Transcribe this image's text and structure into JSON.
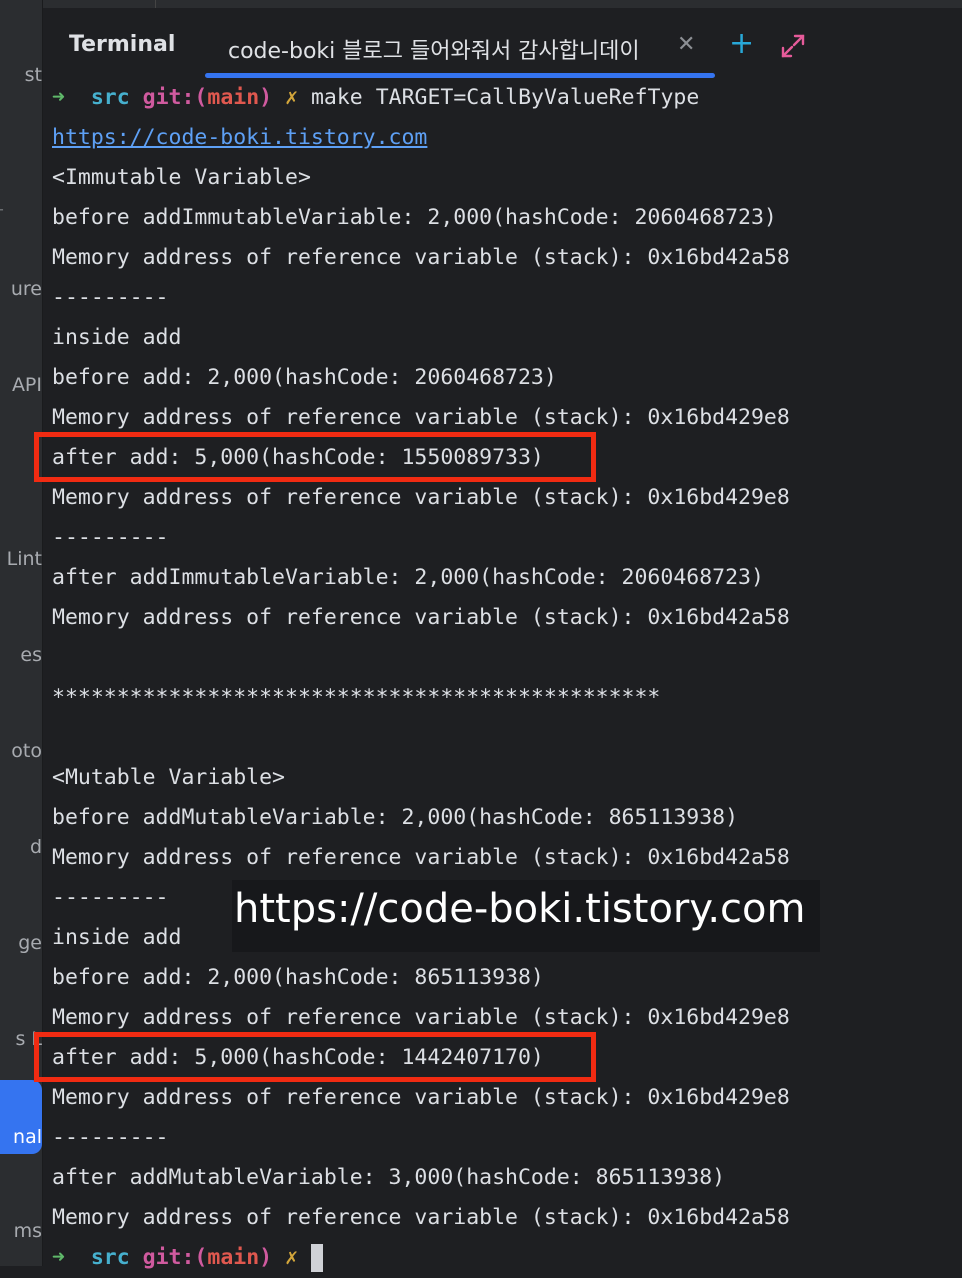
{
  "sidebar": {
    "items": [
      "st",
      "ure",
      "API",
      "Lint",
      "es",
      "oto",
      "d",
      "ge",
      "s L",
      "nal",
      "ms"
    ],
    "active_item": "nal"
  },
  "tabs": {
    "terminal_label": "Terminal",
    "active_tab_label": "code-boki 블로그 들어와줘서 감사합니데이",
    "close_icon": "close-icon",
    "new_tab_icon": "plus-icon",
    "expand_icon": "expand-icon"
  },
  "prompt": {
    "arrow": "➜",
    "dir": "src",
    "git_prefix": "git:(",
    "branch": "main",
    "git_suffix": ")",
    "dirty": "✗",
    "command": "make TARGET=CallByValueRefType"
  },
  "output": {
    "link": "https://code-boki.tistory.com",
    "lines": [
      "<Immutable Variable>",
      "before addImmutableVariable: 2,000(hashCode: 2060468723)",
      "Memory address of reference variable (stack): 0x16bd42a58",
      "---------",
      "inside add",
      "before add: 2,000(hashCode: 2060468723)",
      "Memory address of reference variable (stack): 0x16bd429e8",
      "after add: 5,000(hashCode: 1550089733)",
      "Memory address of reference variable (stack): 0x16bd429e8",
      "---------",
      "after addImmutableVariable: 2,000(hashCode: 2060468723)",
      "Memory address of reference variable (stack): 0x16bd42a58",
      "",
      "***********************************************",
      "",
      "<Mutable Variable>",
      "before addMutableVariable: 2,000(hashCode: 865113938)",
      "Memory address of reference variable (stack): 0x16bd42a58",
      "---------",
      "inside add",
      "before add: 2,000(hashCode: 865113938)",
      "Memory address of reference variable (stack): 0x16bd429e8",
      "after add: 5,000(hashCode: 1442407170)",
      "Memory address of reference variable (stack): 0x16bd429e8",
      "---------",
      "after addMutableVariable: 3,000(hashCode: 865113938)",
      "Memory address of reference variable (stack): 0x16bd42a58"
    ]
  },
  "watermark": "https://code-boki.tistory.com",
  "colors": {
    "background": "#1e1f22",
    "highlight_box": "#f12b12",
    "accent": "#3574f0"
  }
}
